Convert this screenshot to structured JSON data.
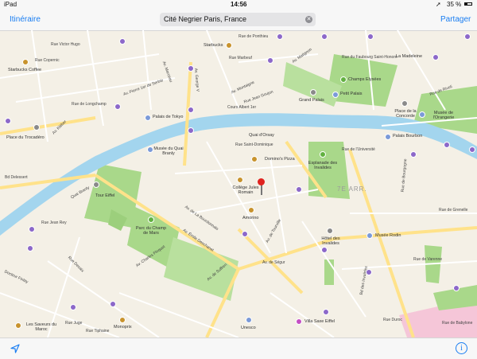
{
  "status": {
    "device": "iPad",
    "time": "14:56",
    "battery": "35 %"
  },
  "nav": {
    "left": "Itinéraire",
    "search": "Cité Negrier Paris, France",
    "right": "Partager"
  },
  "map": {
    "pin": "Cité Negrier",
    "district": "7E ARR.",
    "labels": {
      "place_trocadero": "Place du Trocadéro",
      "palais_tokyo": "Palais de Tokyo",
      "musee_quai_branly": "Musée du Quai Branly",
      "tour_eiffel": "Tour Eiffel",
      "parc_champ_mars": "Parc du Champ de Mars",
      "college_jules_romain": "Collège Jules Romain",
      "dominos": "Domino's Pizza",
      "amorino": "Amorino",
      "esplanade": "Esplanade des Invalides",
      "hotel_invalides": "Hôtel des Invalides",
      "musee_rodin": "Musée Rodin",
      "unesco": "Unesco",
      "villa_saxe": "Villa Saxe Eiffel",
      "grand_palais": "Grand Palais",
      "petit_palais": "Petit Palais",
      "champs_elysees": "Champs Elysées",
      "place_concorde": "Place de la Concorde",
      "musee_orangerie": "Musée de l'Orangerie",
      "palais_bourbon": "Palais Bourbon",
      "la_madeleine": "La Madeleine",
      "starbucks": "Starbucks",
      "starbucks_coffee": "Starbucks Coffee",
      "les_saveurs": "Les Saveurs du Maroc",
      "monoprix": "Monoprix",
      "quai_orsay": "Quai d'Orsay"
    },
    "streets": {
      "rue_copernic": "Rue Copernic",
      "rue_victor_hugo": "Rue Victor Hugo",
      "rue_longchamp": "Rue de Longchamp",
      "av_kleber": "Av. Kléber",
      "av_pierre_serbie": "Av. Pierre 1er de Serbie",
      "av_marceau": "Av. Marceau",
      "av_george_v": "Av. George V",
      "rue_marbeuf": "Rue Marbeuf",
      "av_montaigne": "Av. Montaigne",
      "cours_albert": "Cours Albert 1er",
      "rue_jean_goujon": "Rue Jean Goujon",
      "av_matignon": "Av. Matignon",
      "rue_faubourg": "Rue du Faubourg Saint-Honoré",
      "rue_ponthieu": "Rue de Ponthieu",
      "rue_rivoli": "Rue de Rivoli",
      "rue_universite": "Rue de l'Université",
      "rue_bourgogne": "Rue de Bourgogne",
      "rue_grenelle": "Rue de Grenelle",
      "rue_varenne": "Rue de Varenne",
      "rue_babylone": "Rue de Babylone",
      "av_la_bourdonnais": "Av. de La Bourdonnais",
      "av_emile_deschanel": "Av. Émile Deschanel",
      "av_charles_floquet": "Av. Charles Floquet",
      "av_suffren": "Av. de Suffren",
      "av_segur": "Av. de Ségur",
      "bd_delessert": "Bd Delessert",
      "quai_branly": "Quai Branly",
      "rue_jean_rey": "Rue Jean Rey",
      "rue_desaix": "Rue Desaix",
      "docteur_finlay": "Docteur Finlay",
      "rue_juge": "Rue Juge",
      "rue_tiphaine": "Rue Tiphaine",
      "rue_duroc": "Rue Duroc",
      "av_tourville": "Av. de Tourville",
      "bd_invalides": "Bd des Invalides",
      "rue_dominique": "Rue Saint-Dominique"
    }
  },
  "colors": {
    "water": "#a3d5ee",
    "park": "#a9d88a",
    "land": "#f4f0e6",
    "road": "#fff7d6",
    "major_road": "#ffe28a",
    "accent": "#1a7ef2",
    "pin": "#e0231f"
  },
  "icons": {
    "location": "location-arrow-icon",
    "info": "info-icon"
  }
}
